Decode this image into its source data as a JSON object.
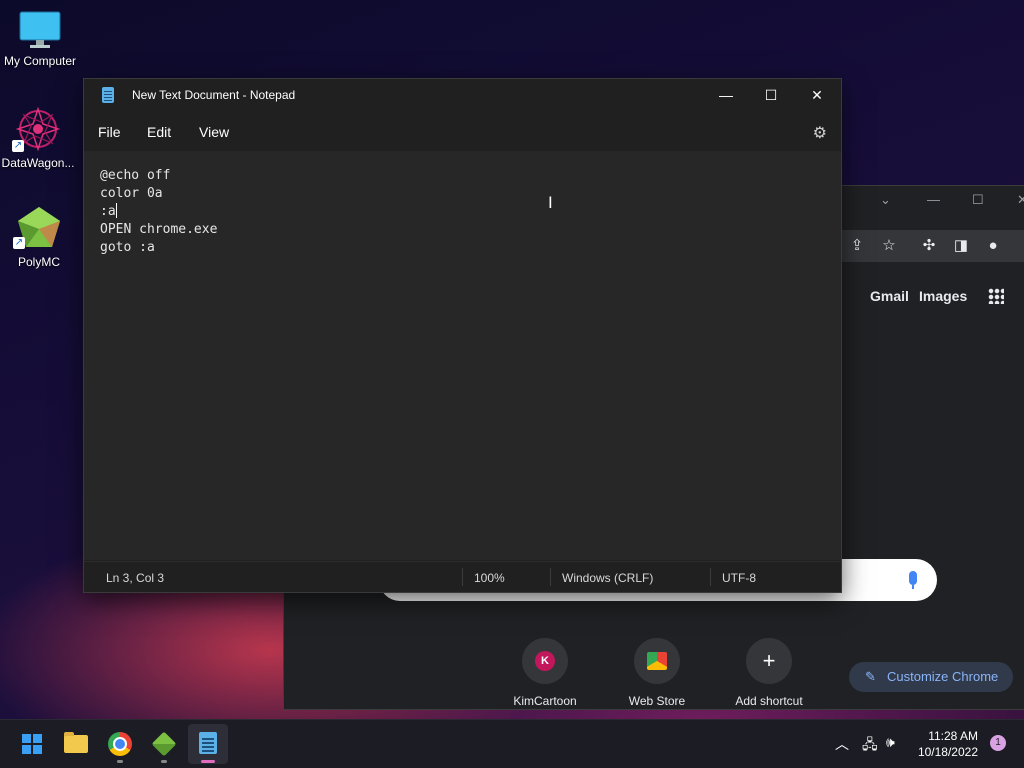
{
  "desktop": {
    "icons": [
      {
        "label": "My Computer",
        "icon": "monitor-icon"
      },
      {
        "label": "DataWagon...",
        "icon": "datawagon-icon",
        "shortcut": true
      },
      {
        "label": "PolyMC",
        "icon": "polymc-icon",
        "shortcut": true
      }
    ]
  },
  "chrome": {
    "links": {
      "gmail": "Gmail",
      "images": "Images"
    },
    "shortcuts": [
      {
        "label": "KimCartoon",
        "initial": "K"
      },
      {
        "label": "Web Store"
      },
      {
        "label": "Add shortcut",
        "glyph": "+"
      }
    ],
    "customize_label": "Customize Chrome"
  },
  "notepad": {
    "title": "New Text Document - Notepad",
    "menu": {
      "file": "File",
      "edit": "Edit",
      "view": "View"
    },
    "content_lines": [
      "@echo off",
      "color 0a",
      ":a",
      "OPEN chrome.exe",
      "goto :a"
    ],
    "status": {
      "position": "Ln 3, Col 3",
      "zoom": "100%",
      "line_ending": "Windows (CRLF)",
      "encoding": "UTF-8"
    }
  },
  "taskbar": {
    "time": "11:28 AM",
    "date": "10/18/2022",
    "notification_count": "1",
    "apps": [
      "start-button",
      "file-explorer",
      "chrome",
      "polymc",
      "notepad"
    ]
  },
  "colors": {
    "notepad_bg": "#272727",
    "chrome_bg": "#202124",
    "accent": "#8ab4f8",
    "kim_avatar": "#c2185b"
  }
}
